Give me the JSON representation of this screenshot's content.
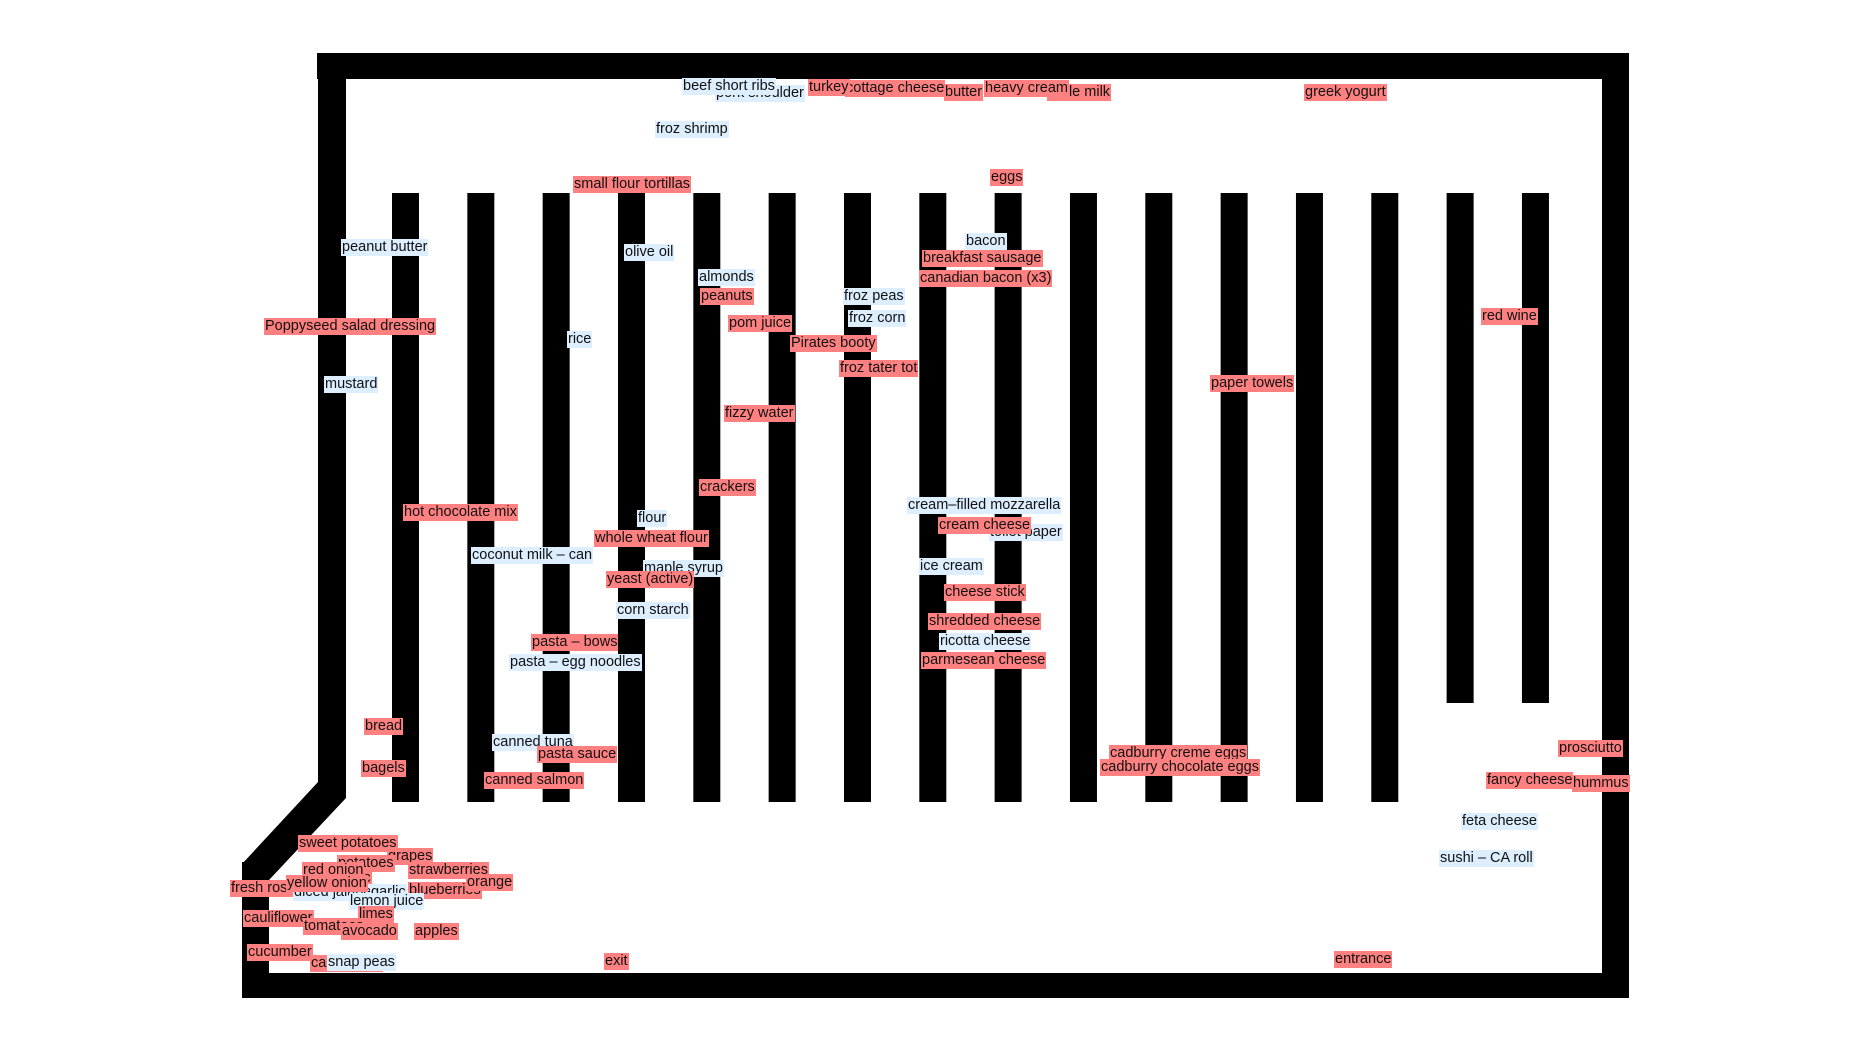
{
  "colors": {
    "needed": "#ff8080",
    "have": "#ddeeff",
    "wall": "#000000",
    "shelf": "#000000"
  },
  "labels": [
    {
      "text": "pork shoulder",
      "type": "have"
    },
    {
      "text": "beef short ribs",
      "type": "have"
    },
    {
      "text": "cottage cheese",
      "type": "needed"
    },
    {
      "text": "turkey",
      "type": "needed"
    },
    {
      "text": "butter",
      "type": "needed"
    },
    {
      "text": "nerle milk",
      "type": "needed"
    },
    {
      "text": "heavy cream",
      "type": "needed"
    },
    {
      "text": "greek yogurt",
      "type": "needed"
    },
    {
      "text": "froz shrimp",
      "type": "have"
    },
    {
      "text": "small flour tortillas",
      "type": "needed"
    },
    {
      "text": "eggs",
      "type": "needed"
    },
    {
      "text": "peanut butter",
      "type": "have"
    },
    {
      "text": "olive oil",
      "type": "have"
    },
    {
      "text": "bacon",
      "type": "have"
    },
    {
      "text": "breakfast sausage",
      "type": "needed"
    },
    {
      "text": "canadian bacon (x3)",
      "type": "needed"
    },
    {
      "text": "almonds",
      "type": "have"
    },
    {
      "text": "peanuts",
      "type": "needed"
    },
    {
      "text": "froz peas",
      "type": "have"
    },
    {
      "text": "froz corn",
      "type": "have"
    },
    {
      "text": "pom juice",
      "type": "needed"
    },
    {
      "text": "red wine",
      "type": "needed"
    },
    {
      "text": "Poppyseed salad dressing",
      "type": "needed"
    },
    {
      "text": "rice",
      "type": "have"
    },
    {
      "text": "Pirates booty",
      "type": "needed"
    },
    {
      "text": "froz tater tot",
      "type": "needed"
    },
    {
      "text": "mustard",
      "type": "have"
    },
    {
      "text": "paper towels",
      "type": "needed"
    },
    {
      "text": "fizzy water",
      "type": "needed"
    },
    {
      "text": "crackers",
      "type": "needed"
    },
    {
      "text": "cream–filled mozzarella",
      "type": "have"
    },
    {
      "text": "hot chocolate mix",
      "type": "needed"
    },
    {
      "text": "flour",
      "type": "have"
    },
    {
      "text": "toilet paper",
      "type": "have"
    },
    {
      "text": "cream cheese",
      "type": "needed"
    },
    {
      "text": "whole wheat flour",
      "type": "needed"
    },
    {
      "text": "coconut milk – can",
      "type": "have"
    },
    {
      "text": "maple syrup",
      "type": "have"
    },
    {
      "text": "yeast (active)",
      "type": "needed"
    },
    {
      "text": "ice cream",
      "type": "have"
    },
    {
      "text": "cheese stick",
      "type": "needed"
    },
    {
      "text": "corn starch",
      "type": "have"
    },
    {
      "text": "shredded cheese",
      "type": "needed"
    },
    {
      "text": "ricotta cheese",
      "type": "have"
    },
    {
      "text": "pasta – bows",
      "type": "needed"
    },
    {
      "text": "parmesean cheese",
      "type": "needed"
    },
    {
      "text": "pasta – egg noodles",
      "type": "have"
    },
    {
      "text": "bread",
      "type": "needed"
    },
    {
      "text": "canned tuna",
      "type": "have"
    },
    {
      "text": "pasta sauce",
      "type": "needed"
    },
    {
      "text": "bagels",
      "type": "needed"
    },
    {
      "text": "canned salmon",
      "type": "needed"
    },
    {
      "text": "cadburry creme eggs",
      "type": "needed"
    },
    {
      "text": "cadburry chocolate eggs",
      "type": "needed"
    },
    {
      "text": "prosciutto",
      "type": "needed"
    },
    {
      "text": "hummus",
      "type": "needed"
    },
    {
      "text": "fancy cheese",
      "type": "needed"
    },
    {
      "text": "feta cheese",
      "type": "have"
    },
    {
      "text": "sushi – CA roll",
      "type": "have"
    },
    {
      "text": "entrance",
      "type": "needed"
    },
    {
      "text": "exit",
      "type": "needed"
    },
    {
      "text": "sweet potatoes",
      "type": "needed"
    },
    {
      "text": "grapes",
      "type": "needed"
    },
    {
      "text": "potatoes",
      "type": "needed"
    },
    {
      "text": "garlic",
      "type": "needed"
    },
    {
      "text": "red onion",
      "type": "needed"
    },
    {
      "text": "fresh rosemary",
      "type": "needed"
    },
    {
      "text": "diced jalapeno",
      "type": "have"
    },
    {
      "text": "garlic",
      "type": "have"
    },
    {
      "text": "yellow onion",
      "type": "needed"
    },
    {
      "text": "blueberries",
      "type": "needed"
    },
    {
      "text": "strawberries",
      "type": "needed"
    },
    {
      "text": "orange",
      "type": "needed"
    },
    {
      "text": "lemon juice",
      "type": "have"
    },
    {
      "text": "limes",
      "type": "needed"
    },
    {
      "text": "cauliflower",
      "type": "needed"
    },
    {
      "text": "tomatoes",
      "type": "needed"
    },
    {
      "text": "avocado",
      "type": "needed"
    },
    {
      "text": "apples",
      "type": "needed"
    },
    {
      "text": "cucumber",
      "type": "needed"
    },
    {
      "text": "cantaloupe",
      "type": "needed"
    },
    {
      "text": "snap peas",
      "type": "have"
    }
  ]
}
